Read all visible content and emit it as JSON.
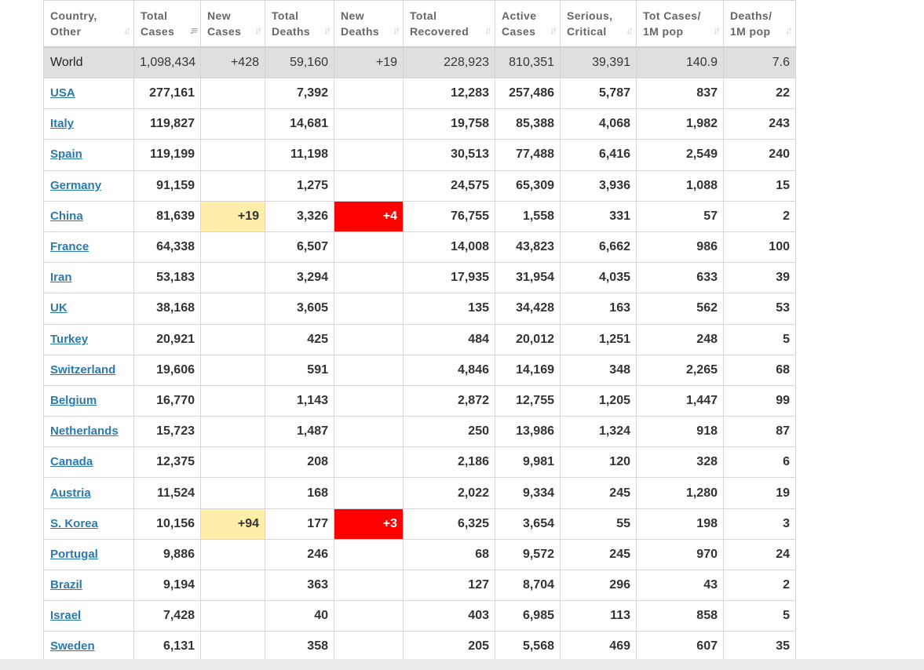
{
  "colors": {
    "link": "#2a7ab0",
    "world_row_bg": "#dfdfdf",
    "new_cases_highlight": "#ffeeaa",
    "new_deaths_highlight": "#ff0000"
  },
  "headers": [
    {
      "line1": "Country,",
      "line2": "Other",
      "sort_icon": "sort-arrows-icon"
    },
    {
      "line1": "Total",
      "line2": "Cases",
      "sort_icon": "sort-desc-icon"
    },
    {
      "line1": "New",
      "line2": "Cases",
      "sort_icon": "sort-arrows-icon"
    },
    {
      "line1": "Total",
      "line2": "Deaths",
      "sort_icon": "sort-arrows-icon"
    },
    {
      "line1": "New",
      "line2": "Deaths",
      "sort_icon": "sort-arrows-icon"
    },
    {
      "line1": "Total",
      "line2": "Recovered",
      "sort_icon": "sort-arrows-icon"
    },
    {
      "line1": "Active",
      "line2": "Cases",
      "sort_icon": "sort-arrows-icon"
    },
    {
      "line1": "Serious,",
      "line2": "Critical",
      "sort_icon": "sort-arrows-icon"
    },
    {
      "line1": "Tot Cases/",
      "line2": "1M pop",
      "sort_icon": "sort-arrows-icon"
    },
    {
      "line1": "Deaths/",
      "line2": "1M pop",
      "sort_icon": "sort-arrows-icon"
    }
  ],
  "world": {
    "country": "World",
    "total_cases": "1,098,434",
    "new_cases": "+428",
    "total_deaths": "59,160",
    "new_deaths": "+19",
    "total_recovered": "228,923",
    "active_cases": "810,351",
    "serious": "39,391",
    "cases_per_1m": "140.9",
    "deaths_per_1m": "7.6"
  },
  "rows": [
    {
      "country": "USA",
      "total_cases": "277,161",
      "new_cases": "",
      "total_deaths": "7,392",
      "new_deaths": "",
      "total_recovered": "12,283",
      "active_cases": "257,486",
      "serious": "5,787",
      "cases_per_1m": "837",
      "deaths_per_1m": "22"
    },
    {
      "country": "Italy",
      "total_cases": "119,827",
      "new_cases": "",
      "total_deaths": "14,681",
      "new_deaths": "",
      "total_recovered": "19,758",
      "active_cases": "85,388",
      "serious": "4,068",
      "cases_per_1m": "1,982",
      "deaths_per_1m": "243"
    },
    {
      "country": "Spain",
      "total_cases": "119,199",
      "new_cases": "",
      "total_deaths": "11,198",
      "new_deaths": "",
      "total_recovered": "30,513",
      "active_cases": "77,488",
      "serious": "6,416",
      "cases_per_1m": "2,549",
      "deaths_per_1m": "240"
    },
    {
      "country": "Germany",
      "total_cases": "91,159",
      "new_cases": "",
      "total_deaths": "1,275",
      "new_deaths": "",
      "total_recovered": "24,575",
      "active_cases": "65,309",
      "serious": "3,936",
      "cases_per_1m": "1,088",
      "deaths_per_1m": "15"
    },
    {
      "country": "China",
      "total_cases": "81,639",
      "new_cases": "+19",
      "total_deaths": "3,326",
      "new_deaths": "+4",
      "total_recovered": "76,755",
      "active_cases": "1,558",
      "serious": "331",
      "cases_per_1m": "57",
      "deaths_per_1m": "2"
    },
    {
      "country": "France",
      "total_cases": "64,338",
      "new_cases": "",
      "total_deaths": "6,507",
      "new_deaths": "",
      "total_recovered": "14,008",
      "active_cases": "43,823",
      "serious": "6,662",
      "cases_per_1m": "986",
      "deaths_per_1m": "100"
    },
    {
      "country": "Iran",
      "total_cases": "53,183",
      "new_cases": "",
      "total_deaths": "3,294",
      "new_deaths": "",
      "total_recovered": "17,935",
      "active_cases": "31,954",
      "serious": "4,035",
      "cases_per_1m": "633",
      "deaths_per_1m": "39"
    },
    {
      "country": "UK",
      "total_cases": "38,168",
      "new_cases": "",
      "total_deaths": "3,605",
      "new_deaths": "",
      "total_recovered": "135",
      "active_cases": "34,428",
      "serious": "163",
      "cases_per_1m": "562",
      "deaths_per_1m": "53"
    },
    {
      "country": "Turkey",
      "total_cases": "20,921",
      "new_cases": "",
      "total_deaths": "425",
      "new_deaths": "",
      "total_recovered": "484",
      "active_cases": "20,012",
      "serious": "1,251",
      "cases_per_1m": "248",
      "deaths_per_1m": "5"
    },
    {
      "country": "Switzerland",
      "total_cases": "19,606",
      "new_cases": "",
      "total_deaths": "591",
      "new_deaths": "",
      "total_recovered": "4,846",
      "active_cases": "14,169",
      "serious": "348",
      "cases_per_1m": "2,265",
      "deaths_per_1m": "68"
    },
    {
      "country": "Belgium",
      "total_cases": "16,770",
      "new_cases": "",
      "total_deaths": "1,143",
      "new_deaths": "",
      "total_recovered": "2,872",
      "active_cases": "12,755",
      "serious": "1,205",
      "cases_per_1m": "1,447",
      "deaths_per_1m": "99"
    },
    {
      "country": "Netherlands",
      "total_cases": "15,723",
      "new_cases": "",
      "total_deaths": "1,487",
      "new_deaths": "",
      "total_recovered": "250",
      "active_cases": "13,986",
      "serious": "1,324",
      "cases_per_1m": "918",
      "deaths_per_1m": "87"
    },
    {
      "country": "Canada",
      "total_cases": "12,375",
      "new_cases": "",
      "total_deaths": "208",
      "new_deaths": "",
      "total_recovered": "2,186",
      "active_cases": "9,981",
      "serious": "120",
      "cases_per_1m": "328",
      "deaths_per_1m": "6"
    },
    {
      "country": "Austria",
      "total_cases": "11,524",
      "new_cases": "",
      "total_deaths": "168",
      "new_deaths": "",
      "total_recovered": "2,022",
      "active_cases": "9,334",
      "serious": "245",
      "cases_per_1m": "1,280",
      "deaths_per_1m": "19"
    },
    {
      "country": "S. Korea",
      "total_cases": "10,156",
      "new_cases": "+94",
      "total_deaths": "177",
      "new_deaths": "+3",
      "total_recovered": "6,325",
      "active_cases": "3,654",
      "serious": "55",
      "cases_per_1m": "198",
      "deaths_per_1m": "3"
    },
    {
      "country": "Portugal",
      "total_cases": "9,886",
      "new_cases": "",
      "total_deaths": "246",
      "new_deaths": "",
      "total_recovered": "68",
      "active_cases": "9,572",
      "serious": "245",
      "cases_per_1m": "970",
      "deaths_per_1m": "24"
    },
    {
      "country": "Brazil",
      "total_cases": "9,194",
      "new_cases": "",
      "total_deaths": "363",
      "new_deaths": "",
      "total_recovered": "127",
      "active_cases": "8,704",
      "serious": "296",
      "cases_per_1m": "43",
      "deaths_per_1m": "2"
    },
    {
      "country": "Israel",
      "total_cases": "7,428",
      "new_cases": "",
      "total_deaths": "40",
      "new_deaths": "",
      "total_recovered": "403",
      "active_cases": "6,985",
      "serious": "113",
      "cases_per_1m": "858",
      "deaths_per_1m": "5"
    },
    {
      "country": "Sweden",
      "total_cases": "6,131",
      "new_cases": "",
      "total_deaths": "358",
      "new_deaths": "",
      "total_recovered": "205",
      "active_cases": "5,568",
      "serious": "469",
      "cases_per_1m": "607",
      "deaths_per_1m": "35"
    }
  ]
}
